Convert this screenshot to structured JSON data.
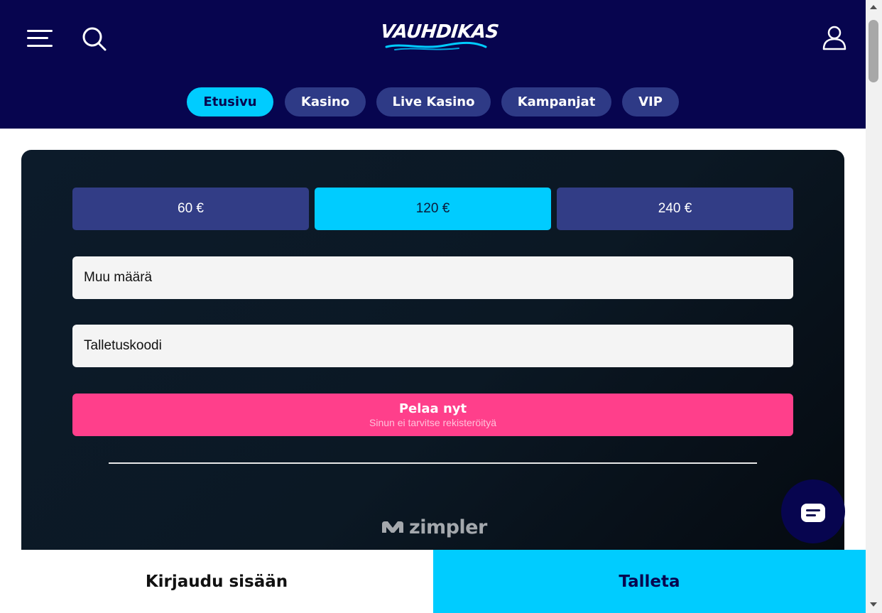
{
  "header": {
    "logo_text": "VAUHDIKAS",
    "icons": {
      "menu": "menu-icon",
      "search": "search-icon",
      "account": "user-icon"
    },
    "colors": {
      "background": "#07054f",
      "accent": "#00ccff",
      "tab": "#2e3a86"
    }
  },
  "nav": {
    "tabs": [
      {
        "label": "Etusivu",
        "active": true
      },
      {
        "label": "Kasino",
        "active": false
      },
      {
        "label": "Live Kasino",
        "active": false
      },
      {
        "label": "Kampanjat",
        "active": false
      },
      {
        "label": "VIP",
        "active": false
      }
    ]
  },
  "deposit": {
    "amounts": [
      {
        "label": "60 €",
        "active": false
      },
      {
        "label": "120 €",
        "active": true
      },
      {
        "label": "240 €",
        "active": false
      }
    ],
    "other_amount_placeholder": "Muu määrä",
    "deposit_code_placeholder": "Talletuskoodi",
    "play_button": {
      "label": "Pelaa nyt",
      "sublabel": "Sinun ei tarvitse rekisteröityä",
      "color": "#ff3f8b"
    },
    "payment_provider": "zimpler"
  },
  "chat": {
    "icon": "chat-icon"
  },
  "bottom_bar": {
    "login_label": "Kirjaudu sisään",
    "deposit_label": "Talleta"
  }
}
